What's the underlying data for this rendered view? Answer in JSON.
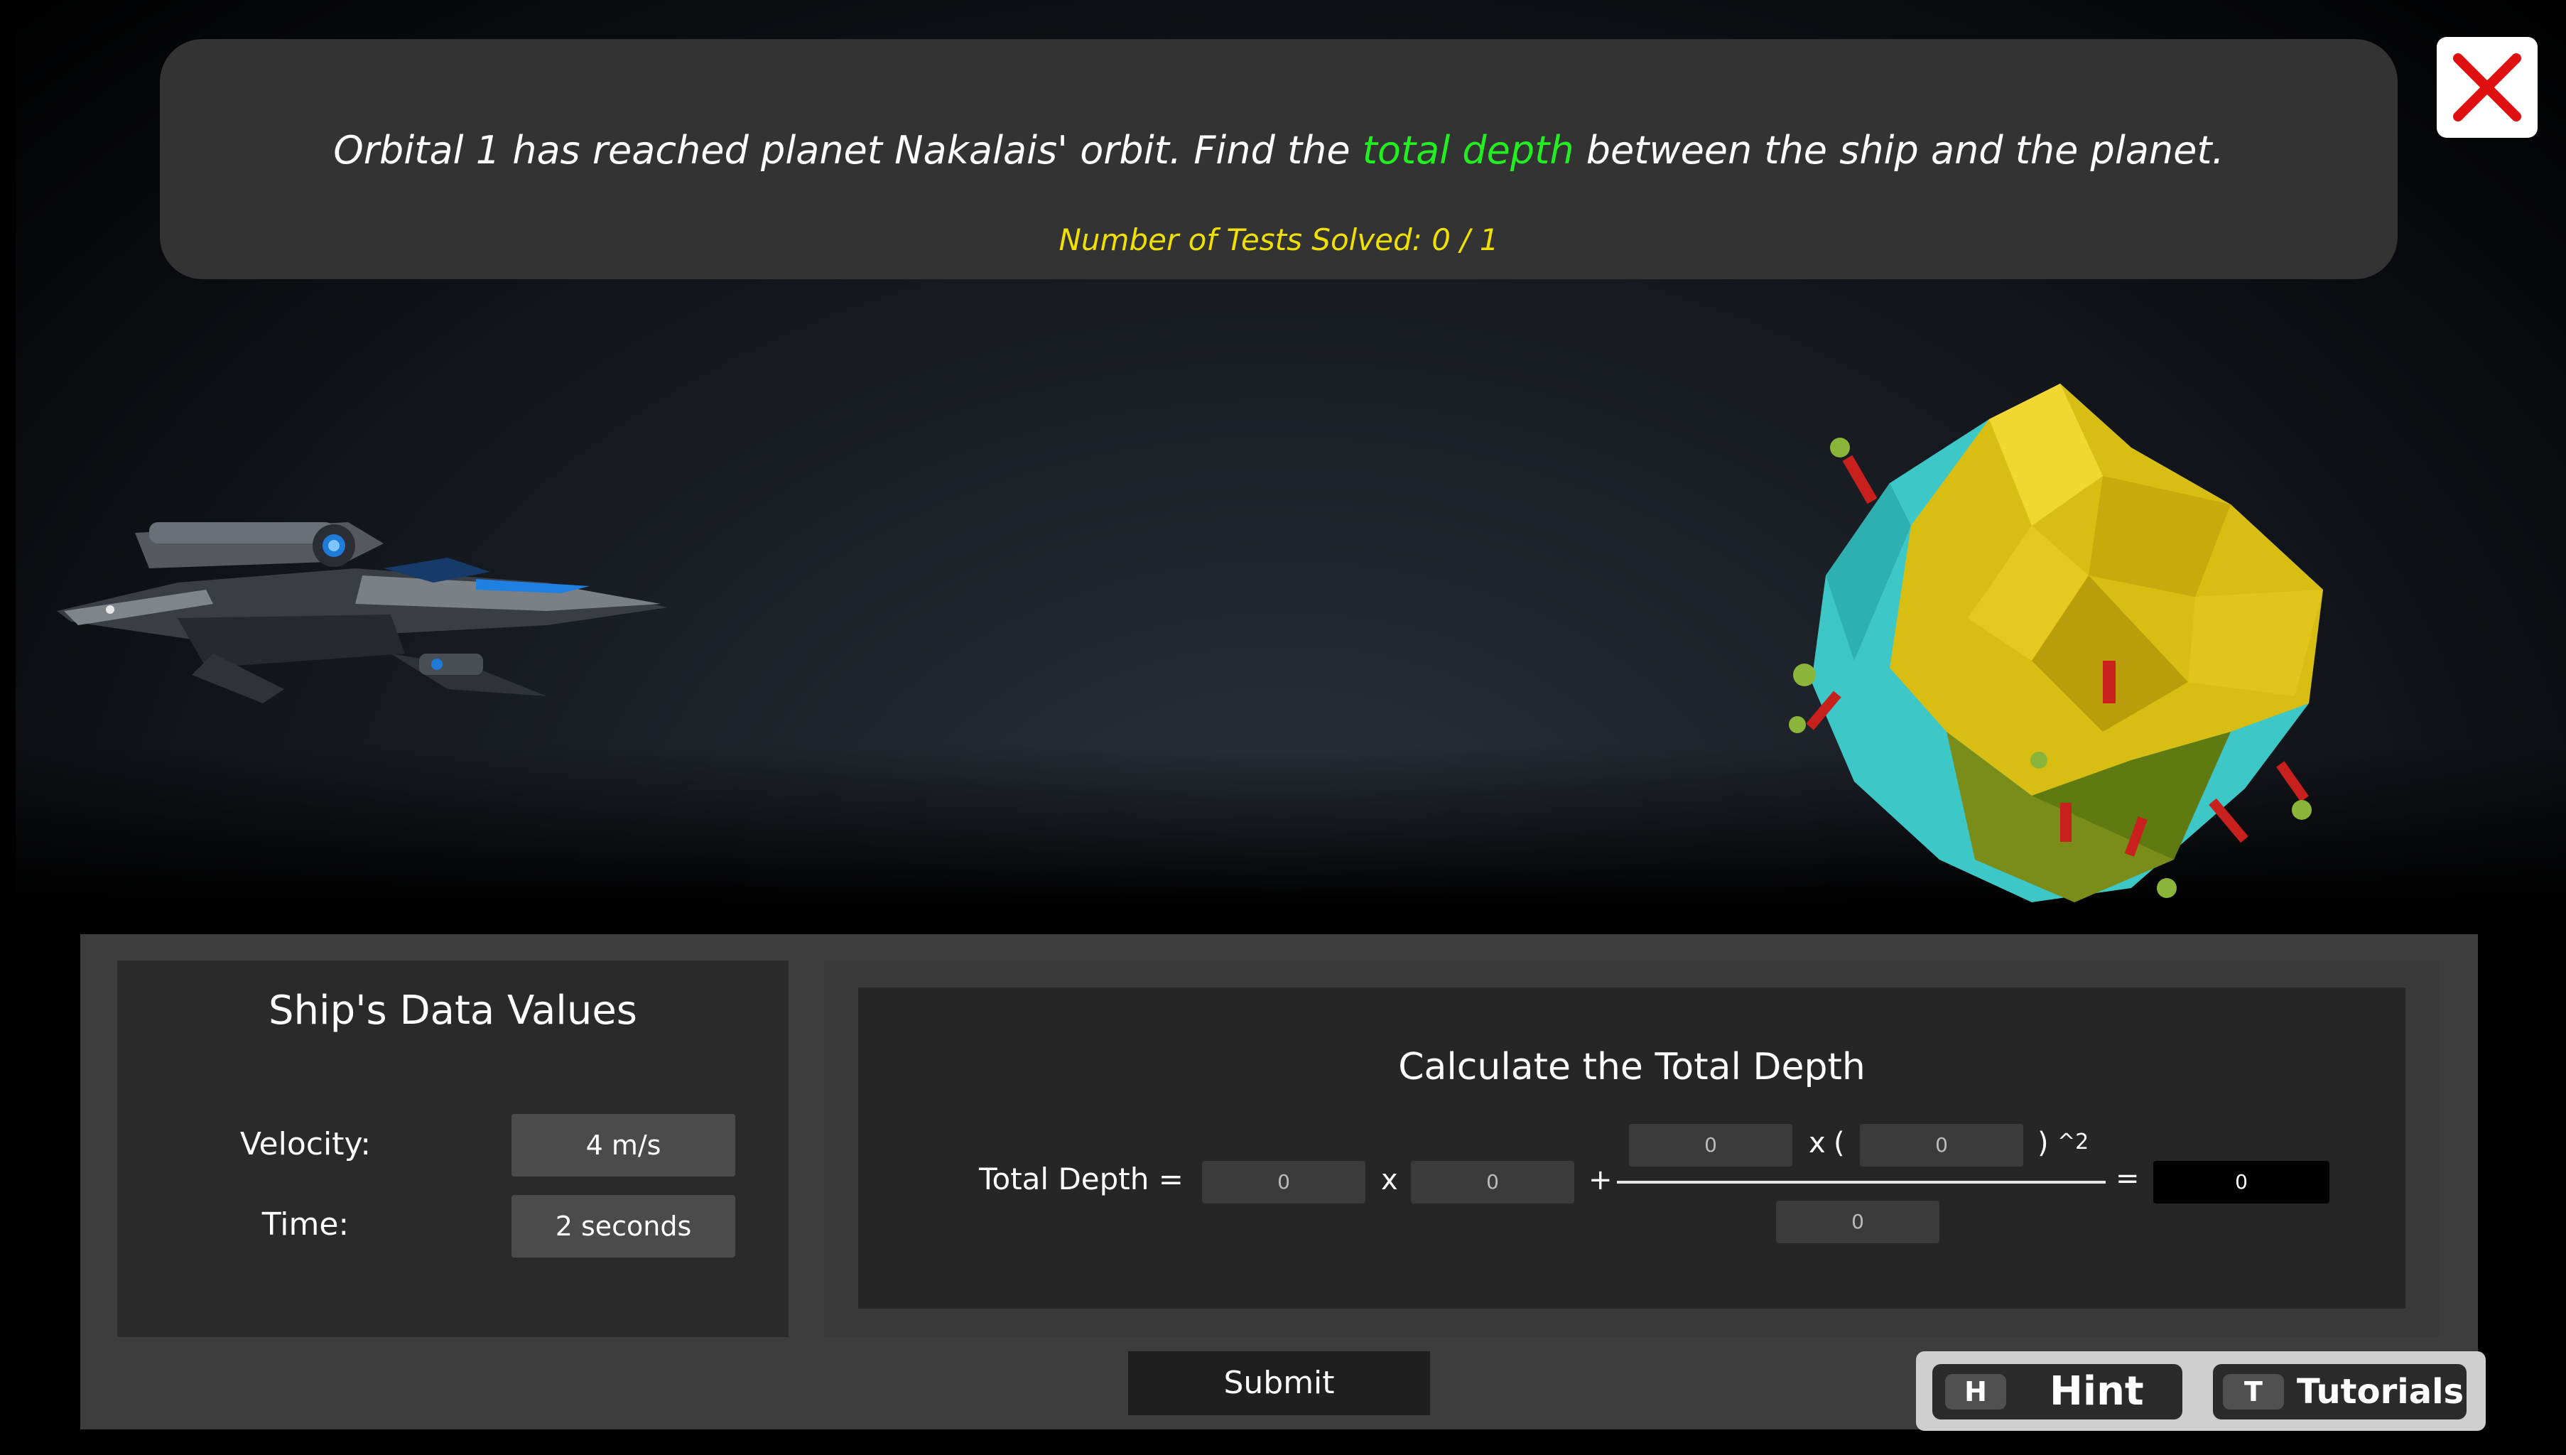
{
  "header": {
    "prompt_before": "Orbital 1 has reached planet Nakalais' orbit. Find the",
    "prompt_highlight": "total depth",
    "prompt_after": "between the ship and the planet.",
    "tests_solved": "Number of Tests Solved: 0 / 1"
  },
  "colors": {
    "highlight": "#22ee22",
    "tests_solved": "#f0e000"
  },
  "ship_data": {
    "title": "Ship's Data Values",
    "velocity_label": "Velocity:",
    "velocity_value": "4 m/s",
    "time_label": "Time:",
    "time_value": "2 seconds"
  },
  "calculator": {
    "title": "Calculate the Total Depth",
    "label": "Total Depth",
    "equals": "=",
    "times": "x",
    "plus": "+",
    "paren_open": "(",
    "paren_close": ")",
    "exponent": "^2",
    "fields": {
      "term1": "0",
      "term2": "0",
      "numerator_a": "0",
      "numerator_b": "0",
      "denominator": "0",
      "result": "0"
    }
  },
  "actions": {
    "submit_label": "Submit",
    "hint_key": "H",
    "hint_label": "Hint",
    "tutorials_key": "T",
    "tutorials_label": "Tutorials"
  },
  "icons": {
    "close": "close-x-icon"
  }
}
